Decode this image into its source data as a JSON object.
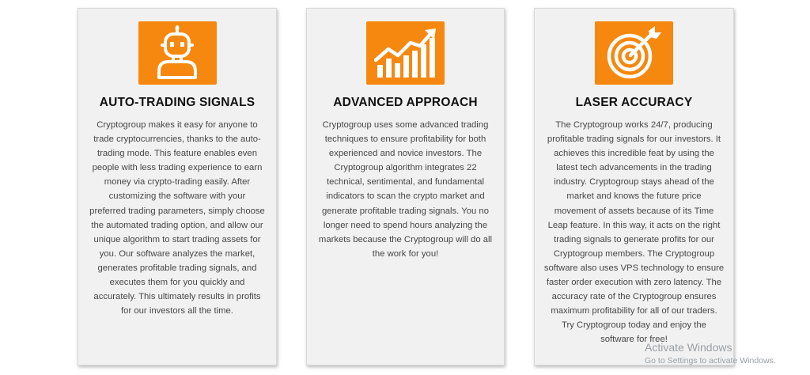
{
  "features": [
    {
      "icon": "robot-icon",
      "title": "AUTO-TRADING SIGNALS",
      "lines": [
        "Cryptogroup makes it easy for anyone to",
        "trade cryptocurrencies, thanks to the auto-",
        "trading mode. This feature enables even",
        "people with less trading experience to earn",
        "money via crypto-trading easily. After",
        "customizing the software with your",
        "preferred trading parameters, simply choose",
        "the automated trading option, and allow our",
        "unique algorithm to start trading assets for",
        "you. Our software analyzes the market,",
        "generates profitable trading signals, and",
        "executes them for you quickly and",
        "accurately. This ultimately results in profits",
        "for our investors all the time."
      ]
    },
    {
      "icon": "growth-chart-icon",
      "title": "ADVANCED APPROACH",
      "lines": [
        "Cryptogroup uses some advanced trading",
        "techniques to ensure profitability for both",
        "experienced and novice investors. The",
        "Cryptogroup algorithm integrates 22",
        "technical, sentimental, and fundamental",
        "indicators to scan the crypto market and",
        "generate profitable trading signals. You no",
        "longer need to spend hours analyzing the",
        "markets because the Cryptogroup will do all",
        "the work for you!"
      ]
    },
    {
      "icon": "target-arrow-icon",
      "title": "LASER ACCURACY",
      "lines": [
        "The Cryptogroup works 24/7, producing",
        "profitable trading signals for our investors. It",
        "achieves this incredible feat by using the",
        "latest tech advancements in the trading",
        "industry. Cryptogroup stays ahead of the",
        "market and knows the future price",
        "movement of assets because of its Time",
        "Leap feature. In this way, it acts on the right",
        "trading signals to generate profits for our",
        "Cryptogroup members. The Cryptogroup",
        "software also uses VPS technology to ensure",
        "faster order execution with zero latency. The",
        "accuracy rate of the Cryptogroup ensures",
        "maximum profitability for all of our traders.",
        "Try Cryptogroup today and enjoy the",
        "software for free!"
      ]
    }
  ],
  "watermark": {
    "title": "Activate Windows",
    "subtitle": "Go to Settings to activate Windows."
  },
  "colors": {
    "accent": "#f7880f",
    "card_background": "#f1f1f1",
    "title_text": "#111111",
    "body_text": "#474747"
  }
}
